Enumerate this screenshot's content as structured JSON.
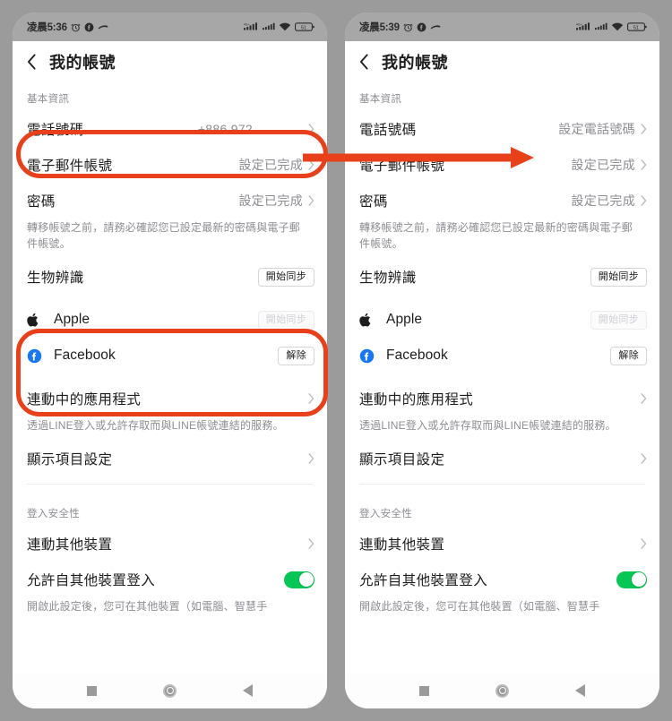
{
  "meta": {
    "accent_red": "#e8401a",
    "toggle_green": "#06c755",
    "background_gray": "#9b9b9b",
    "facebook_blue": "#1877f2"
  },
  "panels": [
    {
      "id": "before",
      "statusbar": {
        "time": "凌晨5:36",
        "battery": "51",
        "icons": [
          "alarm-icon",
          "facebook-icon",
          "app-icon",
          "signal-1-icon",
          "signal-2-icon",
          "wifi-icon",
          "battery-icon"
        ]
      },
      "appbar": {
        "title": "我的帳號",
        "back": "back-icon"
      },
      "sections": [
        {
          "label": "基本資訊",
          "rows": [
            {
              "name": "phone-number",
              "title": "電話號碼",
              "value": "+886 972",
              "redacted": true,
              "chevron": true
            },
            {
              "name": "email-account",
              "title": "電子郵件帳號",
              "value": "設定已完成",
              "chevron": true
            },
            {
              "name": "password",
              "title": "密碼",
              "value": "設定已完成",
              "chevron": true,
              "desc": "轉移帳號之前，請務必確認您已設定最新的密碼與電子郵件帳號。"
            },
            {
              "name": "biometrics",
              "title": "生物辨識",
              "button": "開始同步",
              "button_state": "enabled"
            },
            {
              "name": "apple-account",
              "title": "Apple",
              "icon": "apple-icon",
              "button": "開始同步",
              "button_state": "disabled"
            },
            {
              "name": "facebook-account",
              "title": "Facebook",
              "icon": "facebook-icon",
              "button": "解除",
              "button_state": "enabled"
            },
            {
              "name": "linked-apps",
              "title": "連動中的應用程式",
              "chevron": true,
              "desc": "透過LINE登入或允許存取而與LINE帳號連結的服務。"
            },
            {
              "name": "display-settings",
              "title": "顯示項目設定",
              "chevron": true
            }
          ]
        },
        {
          "label": "登入安全性",
          "rows": [
            {
              "name": "link-other-devices",
              "title": "連動其他裝置",
              "chevron": true
            },
            {
              "name": "allow-login-other-devices",
              "title": "允許自其他裝置登入",
              "toggle": true,
              "toggle_on": true,
              "desc": "開啟此設定後，您可在其他裝置（如電腦、智慧手"
            }
          ]
        }
      ],
      "navbar": {
        "recents": "square-icon",
        "home": "circle-icon",
        "back": "triangle-icon"
      }
    },
    {
      "id": "after",
      "statusbar": {
        "time": "凌晨5:39",
        "battery": "51",
        "icons": [
          "alarm-icon",
          "facebook-icon",
          "app-icon",
          "signal-1-icon",
          "signal-2-icon",
          "wifi-icon",
          "battery-icon"
        ]
      },
      "appbar": {
        "title": "我的帳號",
        "back": "back-icon"
      },
      "sections": [
        {
          "label": "基本資訊",
          "rows": [
            {
              "name": "phone-number",
              "title": "電話號碼",
              "value": "設定電話號碼",
              "redacted": false,
              "chevron": true
            },
            {
              "name": "email-account",
              "title": "電子郵件帳號",
              "value": "設定已完成",
              "chevron": true
            },
            {
              "name": "password",
              "title": "密碼",
              "value": "設定已完成",
              "chevron": true,
              "desc": "轉移帳號之前，請務必確認您已設定最新的密碼與電子郵件帳號。"
            },
            {
              "name": "biometrics",
              "title": "生物辨識",
              "button": "開始同步",
              "button_state": "enabled"
            },
            {
              "name": "apple-account",
              "title": "Apple",
              "icon": "apple-icon",
              "button": "開始同步",
              "button_state": "disabled"
            },
            {
              "name": "facebook-account",
              "title": "Facebook",
              "icon": "facebook-icon",
              "button": "解除",
              "button_state": "enabled"
            },
            {
              "name": "linked-apps",
              "title": "連動中的應用程式",
              "chevron": true,
              "desc": "透過LINE登入或允許存取而與LINE帳號連結的服務。"
            },
            {
              "name": "display-settings",
              "title": "顯示項目設定",
              "chevron": true
            }
          ]
        },
        {
          "label": "登入安全性",
          "rows": [
            {
              "name": "link-other-devices",
              "title": "連動其他裝置",
              "chevron": true
            },
            {
              "name": "allow-login-other-devices",
              "title": "允許自其他裝置登入",
              "toggle": true,
              "toggle_on": true,
              "desc": "開啟此設定後，您可在其他裝置（如電腦、智慧手"
            }
          ]
        }
      ],
      "navbar": {
        "recents": "square-icon",
        "home": "circle-icon",
        "back": "triangle-icon"
      }
    }
  ],
  "annotations": [
    {
      "name": "highlight-phone-number-row",
      "shape": "oval",
      "color": "#e8401a"
    },
    {
      "name": "highlight-social-accounts",
      "shape": "rounded-rect",
      "color": "#e8401a"
    },
    {
      "name": "transition-arrow",
      "shape": "arrow",
      "color": "#e8401a"
    }
  ]
}
